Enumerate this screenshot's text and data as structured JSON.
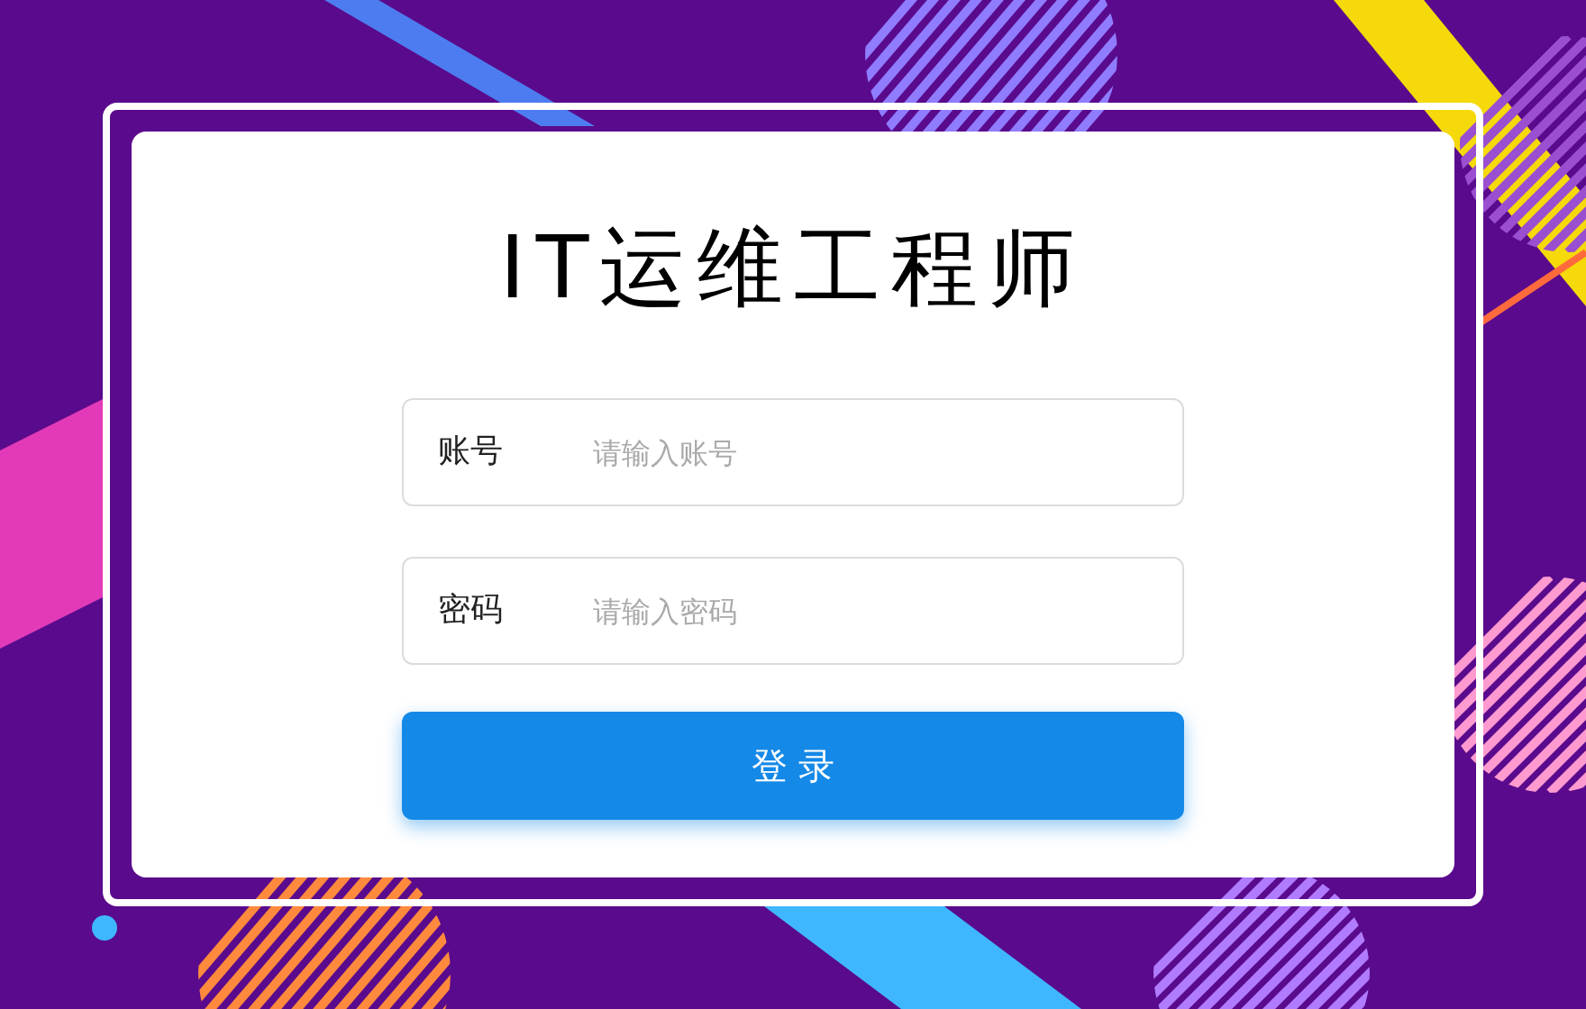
{
  "title": "IT运维工程师",
  "fields": [
    {
      "label": "账号",
      "placeholder": "请输入账号"
    },
    {
      "label": "密码",
      "placeholder": "请输入密码"
    }
  ],
  "button": "登 录"
}
